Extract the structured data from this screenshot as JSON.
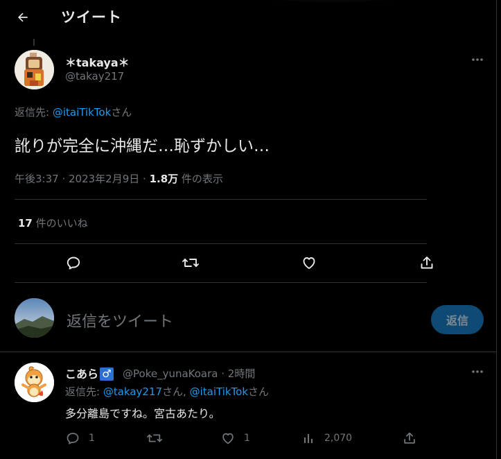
{
  "header": {
    "title": "ツイート"
  },
  "tweet": {
    "author_name": "＊takaya＊",
    "author_handle": "@takay217",
    "reply_prefix": "返信先: ",
    "reply_to": "@itaiTikTok",
    "reply_suffix": "さん",
    "text": "訛りが完全に沖縄だ…恥ずかしい…",
    "time": "午後3:37 · 2023年2月9日 · ",
    "views_count": "1.8万",
    "views_label": " 件の表示",
    "likes_count": "17",
    "likes_label": " 件のいいね"
  },
  "composer": {
    "placeholder": "返信をツイート",
    "button": "返信"
  },
  "reply": {
    "author_name": "こあら",
    "badge": "♂",
    "author_handle": "@Poke_yunaKoara · 2時間",
    "reply_prefix": "返信先: ",
    "reply_to_1": "@takay217",
    "reply_mid": "さん, ",
    "reply_to_2": "@itaiTikTok",
    "reply_suffix": "さん",
    "text": "多分離島ですね。宮古あたり。",
    "reply_count": "1",
    "like_count": "1",
    "view_count": "2,070"
  },
  "icons": [
    "back-arrow-icon",
    "more-icon",
    "reply-icon",
    "retweet-icon",
    "like-icon",
    "share-icon",
    "views-icon"
  ],
  "colors": {
    "link": "#1d9bf0",
    "button": "#0e4a74",
    "muted": "#71767b"
  }
}
